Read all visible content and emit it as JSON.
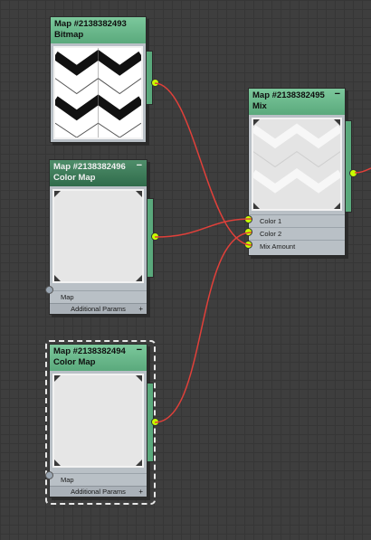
{
  "nodes": {
    "bitmap": {
      "id": "Map #2138382493",
      "type": "Bitmap"
    },
    "color_map_1": {
      "id": "Map #2138382496",
      "type": "Color Map",
      "collapse": "−",
      "map_label": "Map",
      "additional_params": "Additional Params",
      "plus": "+"
    },
    "color_map_2": {
      "id": "Map #2138382494",
      "type": "Color Map",
      "collapse": "−",
      "map_label": "Map",
      "additional_params": "Additional Params",
      "plus": "+"
    },
    "mix": {
      "id": "Map #2138382495",
      "type": "Mix",
      "collapse": "−",
      "inputs": [
        "Color 1",
        "Color 2",
        "Mix Amount"
      ]
    }
  },
  "colors": {
    "wire": "#e0403a",
    "socket": "#c8ff00",
    "header": "#6fbb8e"
  }
}
